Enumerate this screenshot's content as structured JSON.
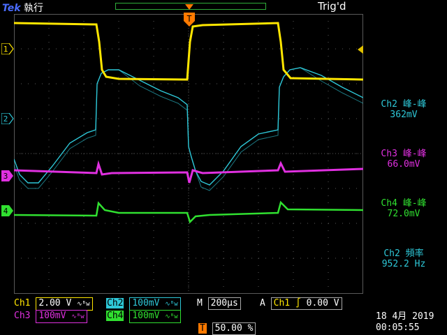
{
  "top": {
    "brand": "Tek",
    "run_state": "執行",
    "trigger_status": "Trig'd"
  },
  "markers": {
    "trigger_pos": "T",
    "ch1": "1",
    "ch2": "2",
    "ch3": "3",
    "ch4": "4"
  },
  "measurements": [
    {
      "title": "Ch2 峰-峰",
      "value": "362mV",
      "color": "#2ec8d8"
    },
    {
      "title": "Ch3 峰-峰",
      "value": "66.0mV",
      "color": "#e030e0"
    },
    {
      "title": "Ch4 峰-峰",
      "value": "72.0mV",
      "color": "#30e030"
    },
    {
      "title": "Ch2 頻率",
      "value": "952.2 Hz",
      "color": "#2ec8d8"
    }
  ],
  "bottom": {
    "ch1_label": "Ch1",
    "ch1_scale": "2.00 V",
    "ch2_label": "Ch2",
    "ch2_scale": "100mV",
    "ch3_label": "Ch3",
    "ch3_scale": "100mV",
    "ch4_label": "Ch4",
    "ch4_scale": "100mV",
    "bw_symbol": "∿ᴮw",
    "timebase_label": "M",
    "timebase": "200µs",
    "trigger_mode": "A",
    "trigger_source": "Ch1",
    "trigger_slope": "∫",
    "trigger_level": "0.00 V",
    "trigger_pos_marker": "T",
    "trigger_position": "50.00 %"
  },
  "datetime": {
    "date": "18 4月  2019",
    "time": "00:05:55"
  },
  "colors": {
    "ch1": "#ffe600",
    "ch2": "#2ec8d8",
    "ch3": "#e030e0",
    "ch4": "#30e030",
    "grid": "#5a5a5a",
    "trigger": "#ff7a00"
  }
}
